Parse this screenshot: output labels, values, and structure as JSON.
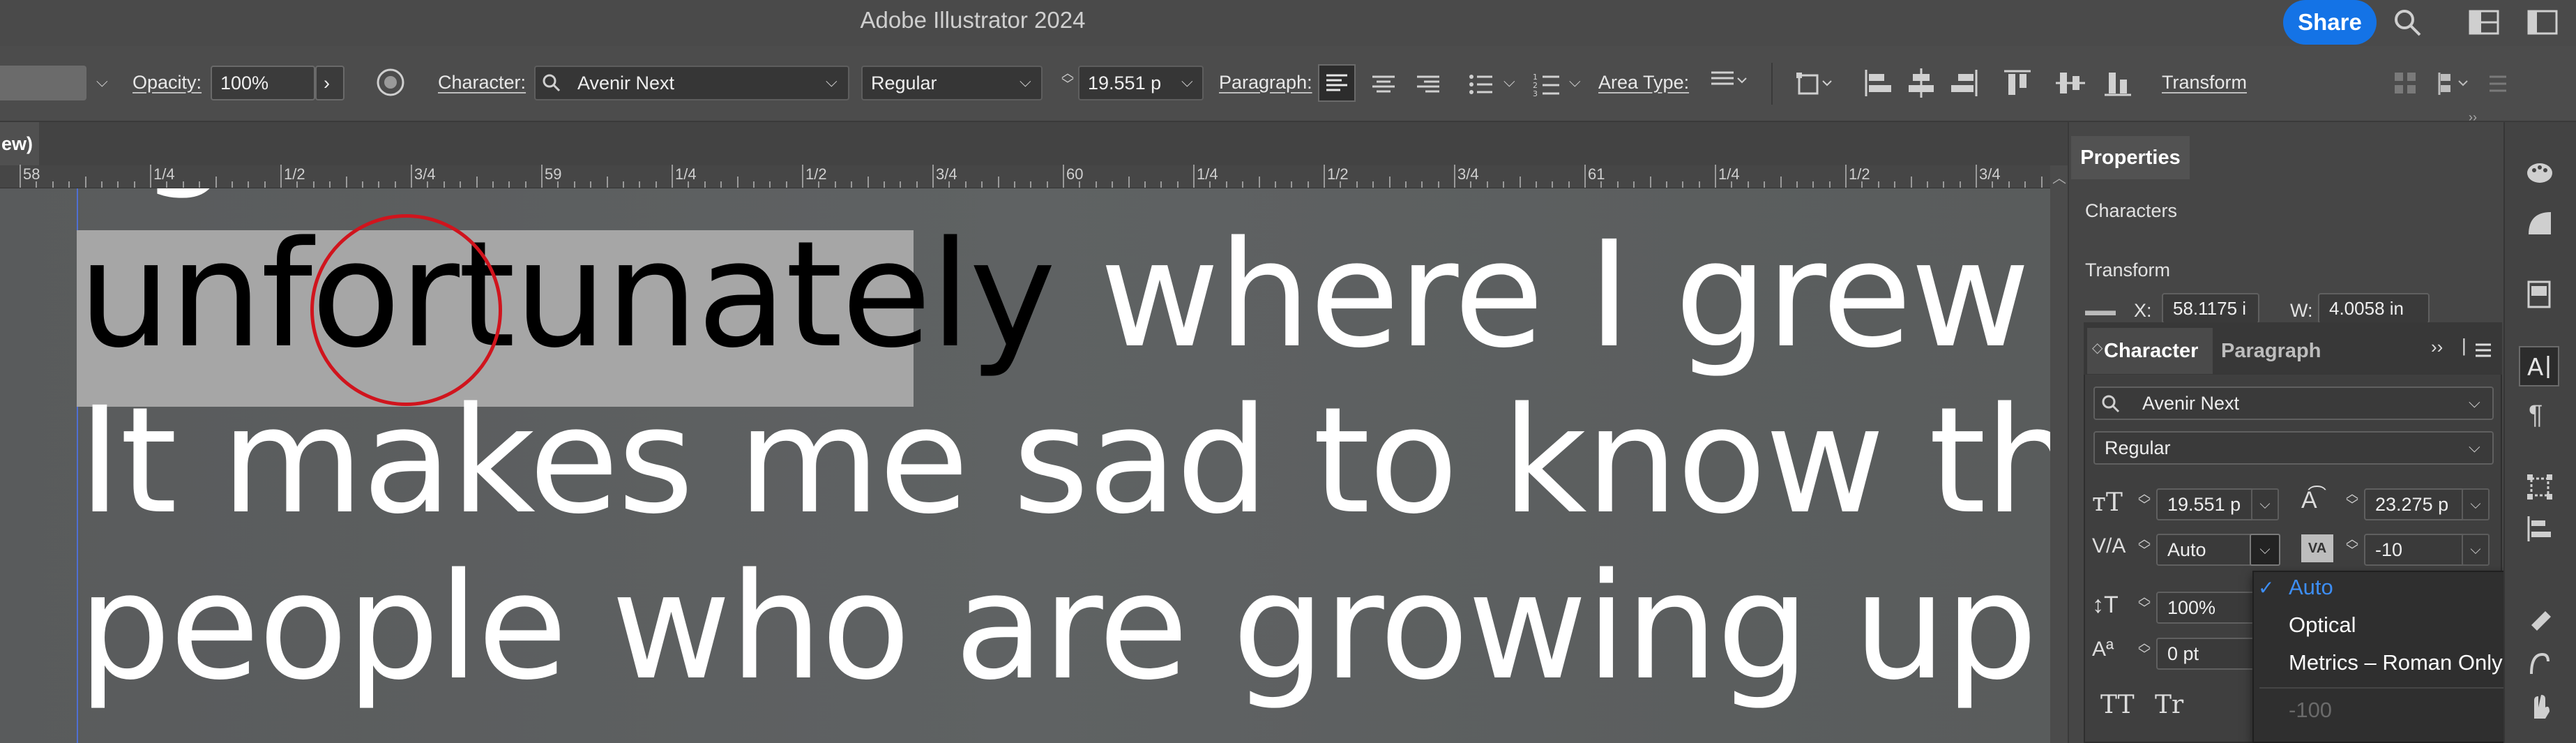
{
  "title_bar": {
    "app_title": "Adobe Illustrator 2024",
    "share_label": "Share"
  },
  "control_bar": {
    "opacity_label": "Opacity:",
    "opacity_value": "100%",
    "character_label": "Character:",
    "font_family": "Avenir Next",
    "font_style": "Regular",
    "font_size": "19.551 p",
    "paragraph_label": "Paragraph:",
    "area_type_label": "Area Type:",
    "transform_label": "Transform"
  },
  "document": {
    "tab_label": "ew)"
  },
  "ruler": {
    "labels": [
      "58",
      "1/4",
      "1/2",
      "3/4",
      "59",
      "1/4",
      "1/2",
      "3/4",
      "60",
      "1/4",
      "1/2",
      "3/4",
      "61",
      "1/4",
      "1/2",
      "3/4"
    ]
  },
  "canvas_text": {
    "line1_selected": "unfortunately",
    "line1_rest": " where I grew up.",
    "line2": "It makes me sad to know that",
    "line3": "people who are growing up in"
  },
  "properties_panel": {
    "tab": "Properties",
    "characters_section": "Characters",
    "transform_section": "Transform",
    "x_label": "X:",
    "x_value": "58.1175 i",
    "w_label": "W:",
    "w_value": "4.0058 in"
  },
  "character_panel": {
    "tab_character": "Character",
    "tab_paragraph": "Paragraph",
    "font_family": "Avenir Next",
    "font_style": "Regular",
    "font_size": "19.551 p",
    "leading": "23.275 p",
    "kerning": "Auto",
    "tracking": "-10",
    "vertical_scale": "100%",
    "baseline_shift": "0 pt",
    "tt_label": "TT",
    "tr_label": "Tr"
  },
  "kerning_dropdown": {
    "items": [
      "Auto",
      "Optical",
      "Metrics – Roman Only",
      "-100"
    ],
    "selected": "Auto",
    "check": "✓"
  },
  "colors": {
    "accent": "#1473e6",
    "selection_highlight": "#a6a6a6",
    "annotation_circle": "#d0141d",
    "dropdown_selected": "#3d8ef5"
  }
}
